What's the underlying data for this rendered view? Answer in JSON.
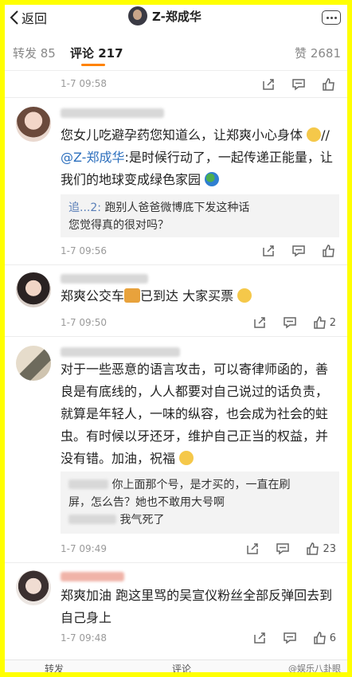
{
  "header": {
    "back_label": "返回",
    "title": "Z-郑成华"
  },
  "tabs": {
    "repost": "转发 85",
    "comments": "评论 217",
    "likes": "赞 2681"
  },
  "top_item": {
    "time": "1-7 09:58"
  },
  "comments": [
    {
      "line1": "您女儿吃避孕药您知道么，让郑爽小心身体",
      "line1b": "//",
      "mention": "@Z-郑成华",
      "line2": ":是时候行动了，一起传递正能量，让",
      "line3": "我们的地球变成绿色家园",
      "reply_who": "追...2:",
      "reply_text1": "跑别人爸爸微博底下发这种话",
      "reply_text2": "您觉得真的很对吗？",
      "time": "1-7 09:56"
    },
    {
      "text": "郑爽公交车",
      "text2": "已到达 大家买票",
      "time": "1-7 09:50",
      "likes": "2"
    },
    {
      "lines": [
        "对于一些恶意的语言攻击，可以寄律师函的，善",
        "良是有底线的，人人都要对自己说过的话负责，",
        "就算是年轻人，一味的纵容，也会成为社会的蛀",
        "虫。有时候以牙还牙，维护自己正当的权益，并",
        "没有错。加油，祝福"
      ],
      "reply1a": "你上面那个号，是才买的，一直在刷",
      "reply1b": "屏，怎么告？她也不敢用大号啊",
      "reply2": "我气死了",
      "time": "1-7 09:49",
      "likes": "23"
    },
    {
      "line1": "郑爽加油 跑这里骂的吴宣仪粉丝全部反弹回去到",
      "line2": "自己身上",
      "time": "1-7 09:48",
      "likes": "6"
    }
  ],
  "bottom": {
    "repost": "转发",
    "comment": "评论",
    "watermark": "@娱乐八卦眼"
  },
  "colors": {
    "frame": "#ffff00",
    "accent": "#ff8200",
    "mention": "#2c6fbd"
  },
  "icons": [
    "back-icon",
    "more-icon",
    "share-icon",
    "comment-icon",
    "like-icon",
    "blush-emoji",
    "globe-emoji",
    "bus-emoji",
    "laugh-emoji",
    "sweat-emoji"
  ]
}
